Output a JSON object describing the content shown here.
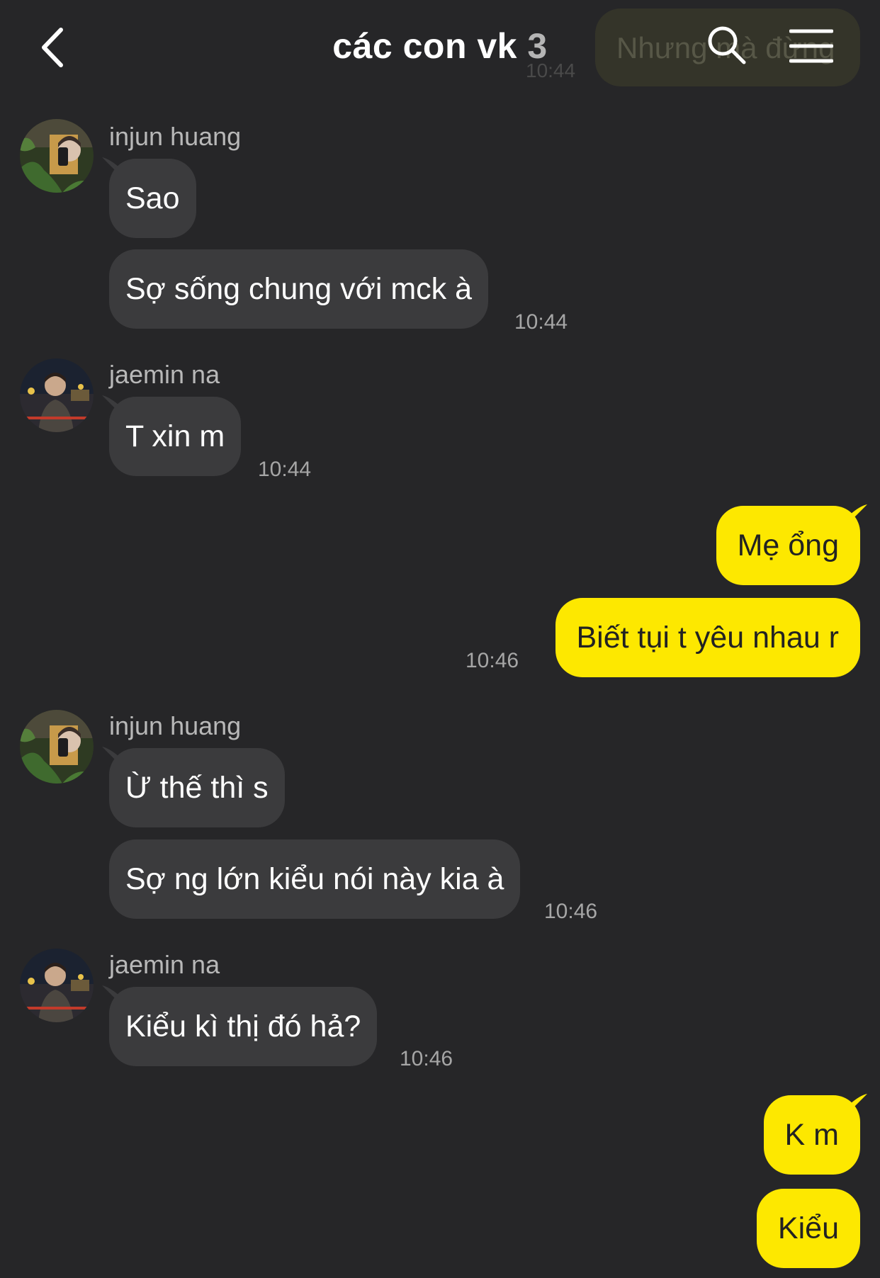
{
  "header": {
    "title": "các con vk",
    "member_count": "3",
    "ghost_message": "Nhưng mà đừng",
    "ghost_time": "10:44"
  },
  "messages": {
    "g1": {
      "sender": "injun huang",
      "m1": "Sao",
      "m2": "Sợ sống chung với mck à",
      "time": "10:44"
    },
    "g2": {
      "sender": "jaemin na",
      "m1": "T xin m",
      "time": "10:44"
    },
    "g3": {
      "m1": "Mẹ ổng",
      "m2": "Biết tụi t yêu nhau r",
      "time": "10:46"
    },
    "g4": {
      "sender": "injun huang",
      "m1": "Ừ thế thì s",
      "m2": "Sợ ng lớn kiểu nói này kia à",
      "time": "10:46"
    },
    "g5": {
      "sender": "jaemin na",
      "m1": "Kiểu kì thị đó hả?",
      "time": "10:46"
    },
    "g6": {
      "m1": "K m",
      "m2": "Kiểu"
    }
  },
  "colors": {
    "background": "#262628",
    "incoming_bubble": "#3b3b3d",
    "outgoing_bubble": "#fde800"
  },
  "icons": [
    "back-arrow",
    "search",
    "menu"
  ]
}
